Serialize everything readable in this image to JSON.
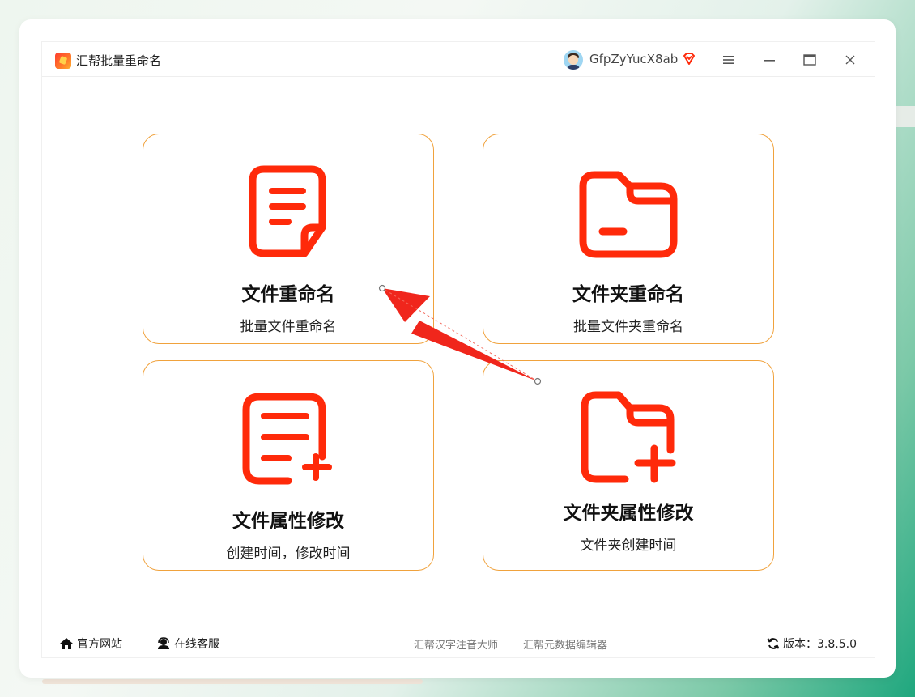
{
  "app": {
    "title": "汇帮批量重命名",
    "username": "GfpZyYucX8ab"
  },
  "cards": [
    {
      "title": "文件重命名",
      "subtitle": "批量文件重命名",
      "icon": "file-document-icon"
    },
    {
      "title": "文件夹重命名",
      "subtitle": "批量文件夹重命名",
      "icon": "folder-icon"
    },
    {
      "title": "文件属性修改",
      "subtitle": "创建时间，修改时间",
      "icon": "file-add-icon"
    },
    {
      "title": "文件夹属性修改",
      "subtitle": "文件夹创建时间",
      "icon": "folder-add-icon"
    }
  ],
  "footer": {
    "website": "官方网站",
    "support": "在线客服",
    "link1": "汇帮汉字注音大师",
    "link2": "汇帮元数据编辑器",
    "version": "版本：3.8.5.0"
  },
  "colors": {
    "accent": "#ff2a0a",
    "card_border": "#f0a23d",
    "annotation_arrow": "#f0261c"
  }
}
